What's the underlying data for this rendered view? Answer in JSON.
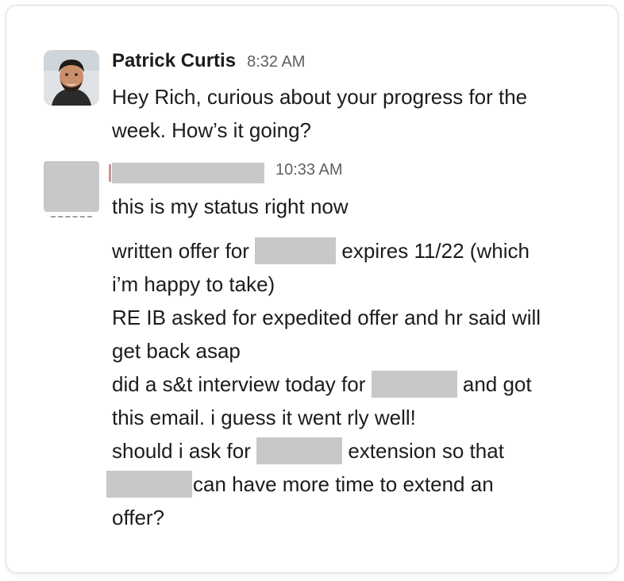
{
  "messages": [
    {
      "sender": "Patrick Curtis",
      "time": "8:32 AM",
      "lines": [
        "Hey Rich, curious about your progress for the",
        "week. How’s it going?"
      ]
    },
    {
      "sender": "",
      "time": "10:33 AM",
      "intro": "this is my status right now",
      "line1_a": "written offer for",
      "line1_b": "expires 11/22 (which",
      "line2": "i’m happy to take)",
      "line3": "RE IB asked for expedited offer and hr said will",
      "line4": "get back asap",
      "line5_a": "did a s&t interview today for",
      "line5_b": "and got",
      "line6": "this email. i guess it went rly well!",
      "line7_a": "should i ask for",
      "line7_b": "extension so that",
      "line8_b": "can have more time to extend an",
      "line9": "offer?"
    }
  ],
  "colors": {
    "text": "#1d1c1d",
    "timestamp": "#616061",
    "redaction": "#c8c8c8",
    "card_border": "#dcdcdc"
  }
}
